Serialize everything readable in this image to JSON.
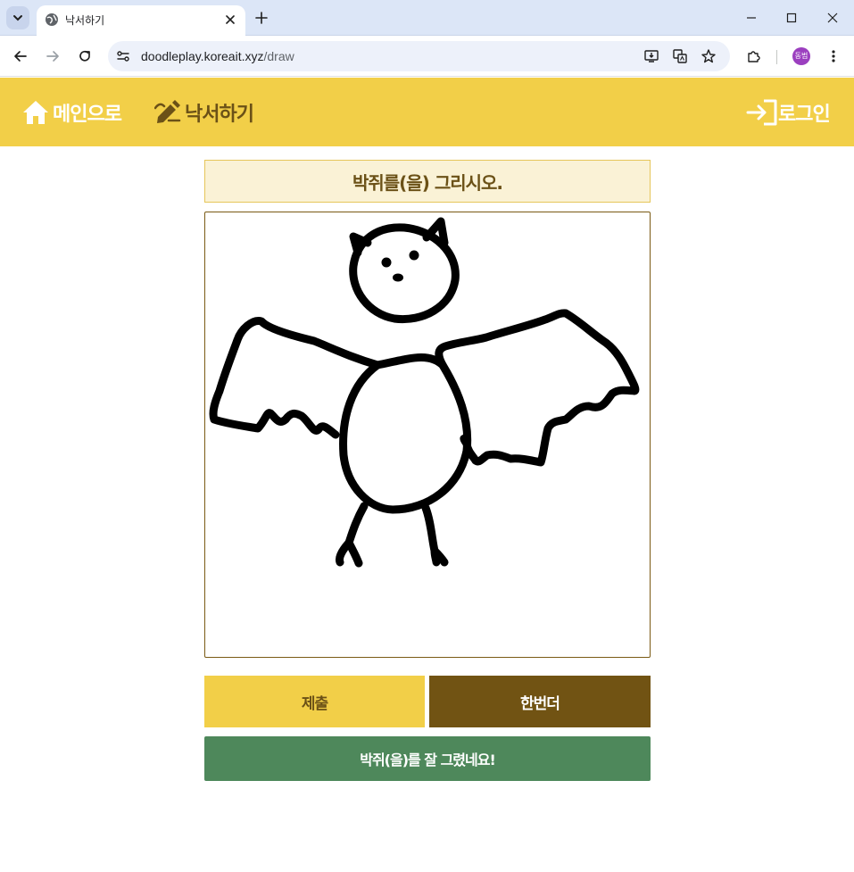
{
  "browser": {
    "tab_title": "낙서하기",
    "url_host": "doodleplay.koreait.xyz",
    "url_path": "/draw",
    "profile_initials": "동범"
  },
  "header": {
    "home_label": "메인으로",
    "draw_label": "낙서하기",
    "login_label": "로그인",
    "bg_color": "#f2cf48",
    "home_color": "#ffffff",
    "draw_color": "#6b5117"
  },
  "main": {
    "prompt": "박쥐를(을) 그리시오.",
    "submit_label": "제출",
    "again_label": "한번더",
    "result_message": "박쥐(을)를 잘 그렸네요!",
    "colors": {
      "prompt_bg": "#faf2d6",
      "submit_bg": "#f2cf48",
      "again_bg": "#715313",
      "result_bg": "#4e885b"
    }
  }
}
